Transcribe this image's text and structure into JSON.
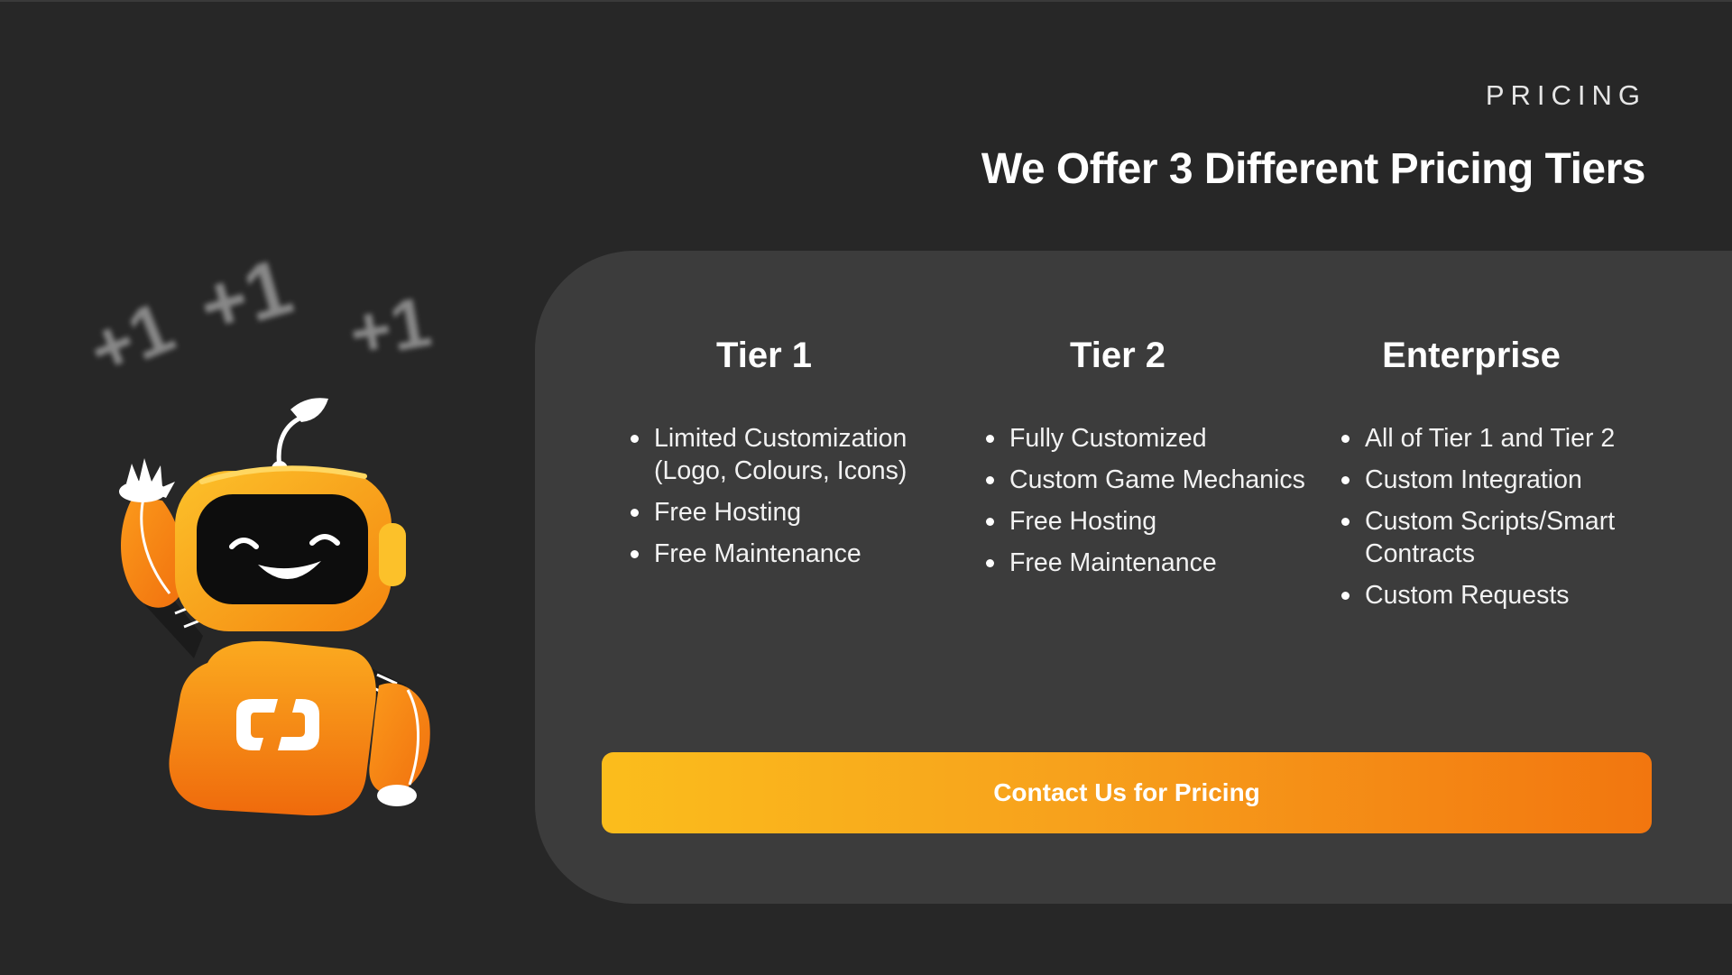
{
  "header": {
    "eyebrow": "PRICING",
    "title": "We Offer 3 Different Pricing Tiers"
  },
  "decorations": {
    "plus_one_marks": [
      "+1",
      "+1",
      "+1"
    ],
    "mascot_icon": "robot-mascot-icon"
  },
  "tiers": [
    {
      "title": "Tier 1",
      "features": [
        "Limited Customization (Logo, Colours, Icons)",
        "Free Hosting",
        "Free Maintenance"
      ]
    },
    {
      "title": "Tier 2",
      "features": [
        "Fully Customized",
        "Custom Game Mechanics",
        "Free Hosting",
        "Free Maintenance"
      ]
    },
    {
      "title": "Enterprise",
      "features": [
        "All of Tier 1 and Tier 2",
        "Custom Integration",
        "Custom Scripts/Smart Contracts",
        "Custom Requests"
      ]
    }
  ],
  "cta": {
    "label": "Contact Us for Pricing"
  },
  "colors": {
    "background": "#272727",
    "panel": "#3c3c3c",
    "accent_start": "#fbbd1c",
    "accent_end": "#f2760f",
    "mascot_orange": "#f7941d"
  }
}
